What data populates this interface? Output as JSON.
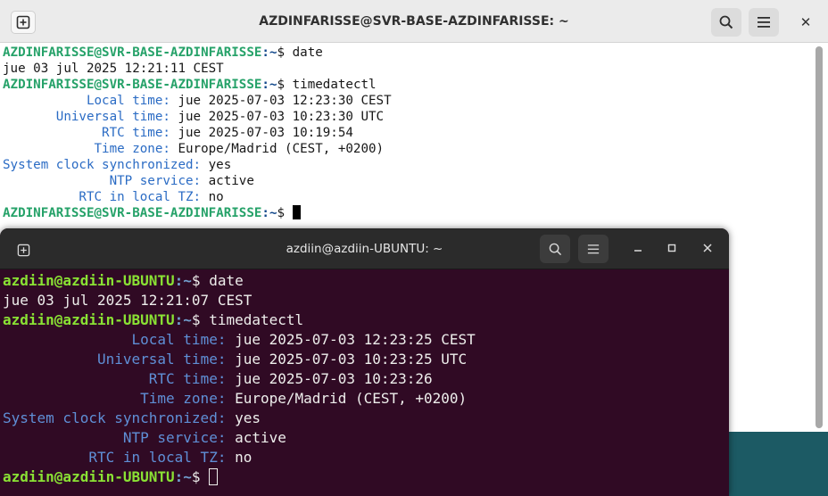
{
  "back_terminal": {
    "title": "AZDINFARISSE@SVR-BASE-AZDINFARISSE: ~",
    "close_glyph": "✕",
    "prompt_user_host": "AZDINFARISSE@SVR-BASE-AZDINFARISSE",
    "prompt_path": ":~",
    "prompt_symbol": "$ ",
    "cmd_date": "date",
    "date_output": "jue 03 jul 2025 12:21:11 CEST",
    "cmd_timedatectl": "timedatectl",
    "rows": [
      {
        "label": "Local time: ",
        "value": "jue 2025-07-03 12:23:30 CEST"
      },
      {
        "label": "Universal time: ",
        "value": "jue 2025-07-03 10:23:30 UTC"
      },
      {
        "label": "RTC time: ",
        "value": "jue 2025-07-03 10:19:54"
      },
      {
        "label": "Time zone: ",
        "value": "Europe/Madrid (CEST, +0200)"
      },
      {
        "label": "System clock synchronized: ",
        "value": "yes"
      },
      {
        "label": "NTP service: ",
        "value": "active"
      },
      {
        "label": "RTC in local TZ: ",
        "value": "no"
      }
    ]
  },
  "front_terminal": {
    "title": "azdiin@azdiin-UBUNTU: ~",
    "prompt_user_host": "azdiin@azdiin-UBUNTU",
    "prompt_path": ":~",
    "prompt_symbol": "$ ",
    "cmd_date": "date",
    "date_output": "jue 03 jul 2025 12:21:07 CEST",
    "cmd_timedatectl": "timedatectl",
    "rows": [
      {
        "label": "Local time: ",
        "value": "jue 2025-07-03 12:23:25 CEST"
      },
      {
        "label": "Universal time: ",
        "value": "jue 2025-07-03 10:23:25 UTC"
      },
      {
        "label": "RTC time: ",
        "value": "jue 2025-07-03 10:23:26"
      },
      {
        "label": "Time zone: ",
        "value": "Europe/Madrid (CEST, +0200)"
      },
      {
        "label": "System clock synchronized: ",
        "value": "yes"
      },
      {
        "label": "NTP service: ",
        "value": "active"
      },
      {
        "label": "RTC in local TZ: ",
        "value": "no"
      }
    ]
  },
  "icons": {
    "new_tab": "new-tab-icon",
    "search": "search-icon",
    "menu": "hamburger-menu-icon",
    "minimize": "minimize-icon",
    "maximize": "maximize-icon",
    "close": "close-icon"
  },
  "colors": {
    "back_prompt_user": "#26a269",
    "back_prompt_path": "#12488b",
    "back_label": "#2a6bc4",
    "front_bg": "#300a24",
    "front_prompt_user": "#8ae234",
    "front_prompt_path": "#729fcf",
    "desktop": "#1c5a64"
  }
}
